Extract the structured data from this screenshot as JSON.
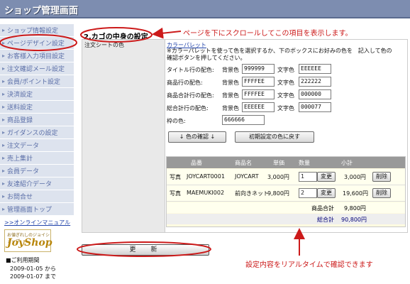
{
  "header": {
    "title": "ショップ管理画面"
  },
  "sidebar": {
    "items": [
      "ショップ情報設定",
      "ページデザイン設定",
      "お客様入力項目設定",
      "注文確認メール設定",
      "会員/ポイント設定",
      "決済設定",
      "送料設定",
      "商品登録",
      "ガイダンスの設定",
      "注文データ",
      "売上集計",
      "会員データ",
      "友達紹介データ",
      "お問合せ",
      "管理画面トップ"
    ],
    "manual_link": ">>オンラインマニュアル",
    "logo_sub": "お値ぎれしのジョイショップ",
    "logo_main": "JoyShop",
    "period_title": "■ご利用期間",
    "period_from": "2009-01-05  から",
    "period_to": "2009-01-07  まで"
  },
  "main": {
    "section_title": "2.カゴの中身の設定",
    "left_label": "注文シートの色",
    "palette_link": "カラーパレット",
    "instruction": "※カラーパレットを使って色を選択するか、下のボックスにお好みの色を　記入して色の確認ボタンを押してください。",
    "bg_tag": "背景色",
    "text_tag": "文字色",
    "color_rows": [
      {
        "label": "タイトル行の配色:",
        "bg": "999999",
        "text": "EEEEEE"
      },
      {
        "label": "商品行の配色:",
        "bg": "FFFFEE",
        "text": "222222"
      },
      {
        "label": "商品合計行の配色:",
        "bg": "FFFFEE",
        "text": "000000"
      },
      {
        "label": "総合計行の配色:",
        "bg": "EEEEEE",
        "text": "000077"
      }
    ],
    "border_label": "枠の色:",
    "border_value": "666666",
    "confirm_button": "↓ 色の確認 ↓",
    "reset_button": "初期設定の色に戻す"
  },
  "cart": {
    "headers": [
      "品番",
      "商品名",
      "単価",
      "数量",
      "小計"
    ],
    "rows": [
      {
        "photo": "写真",
        "code": "JOYCART0001",
        "name": "JOYCART",
        "price": "3,000円",
        "qty": "1",
        "change": "変更",
        "subtotal": "3,000円",
        "delete": "削除"
      },
      {
        "photo": "写真",
        "code": "MAEMUKI002",
        "name": "前向きネット",
        "price": "9,800円",
        "qty": "2",
        "change": "変更",
        "subtotal": "19,600円",
        "delete": "削除"
      }
    ],
    "product_total_label": "商品合計",
    "product_total": "9,800円",
    "grand_total_label": "総合計",
    "grand_total": "90,800円"
  },
  "update_button": "更　新",
  "annotations": {
    "top": "ページを下にスクロールしてこの項目を表示します。",
    "bottom": "設定内容をリアルタイムで確認できます"
  },
  "colors": {
    "header_bg": "#7d8db0",
    "annotation": "#cc1a1a",
    "menu_bg": "#dde3ee",
    "cart_title_bg": "#999999",
    "cart_row_bg": "#ffffee"
  }
}
